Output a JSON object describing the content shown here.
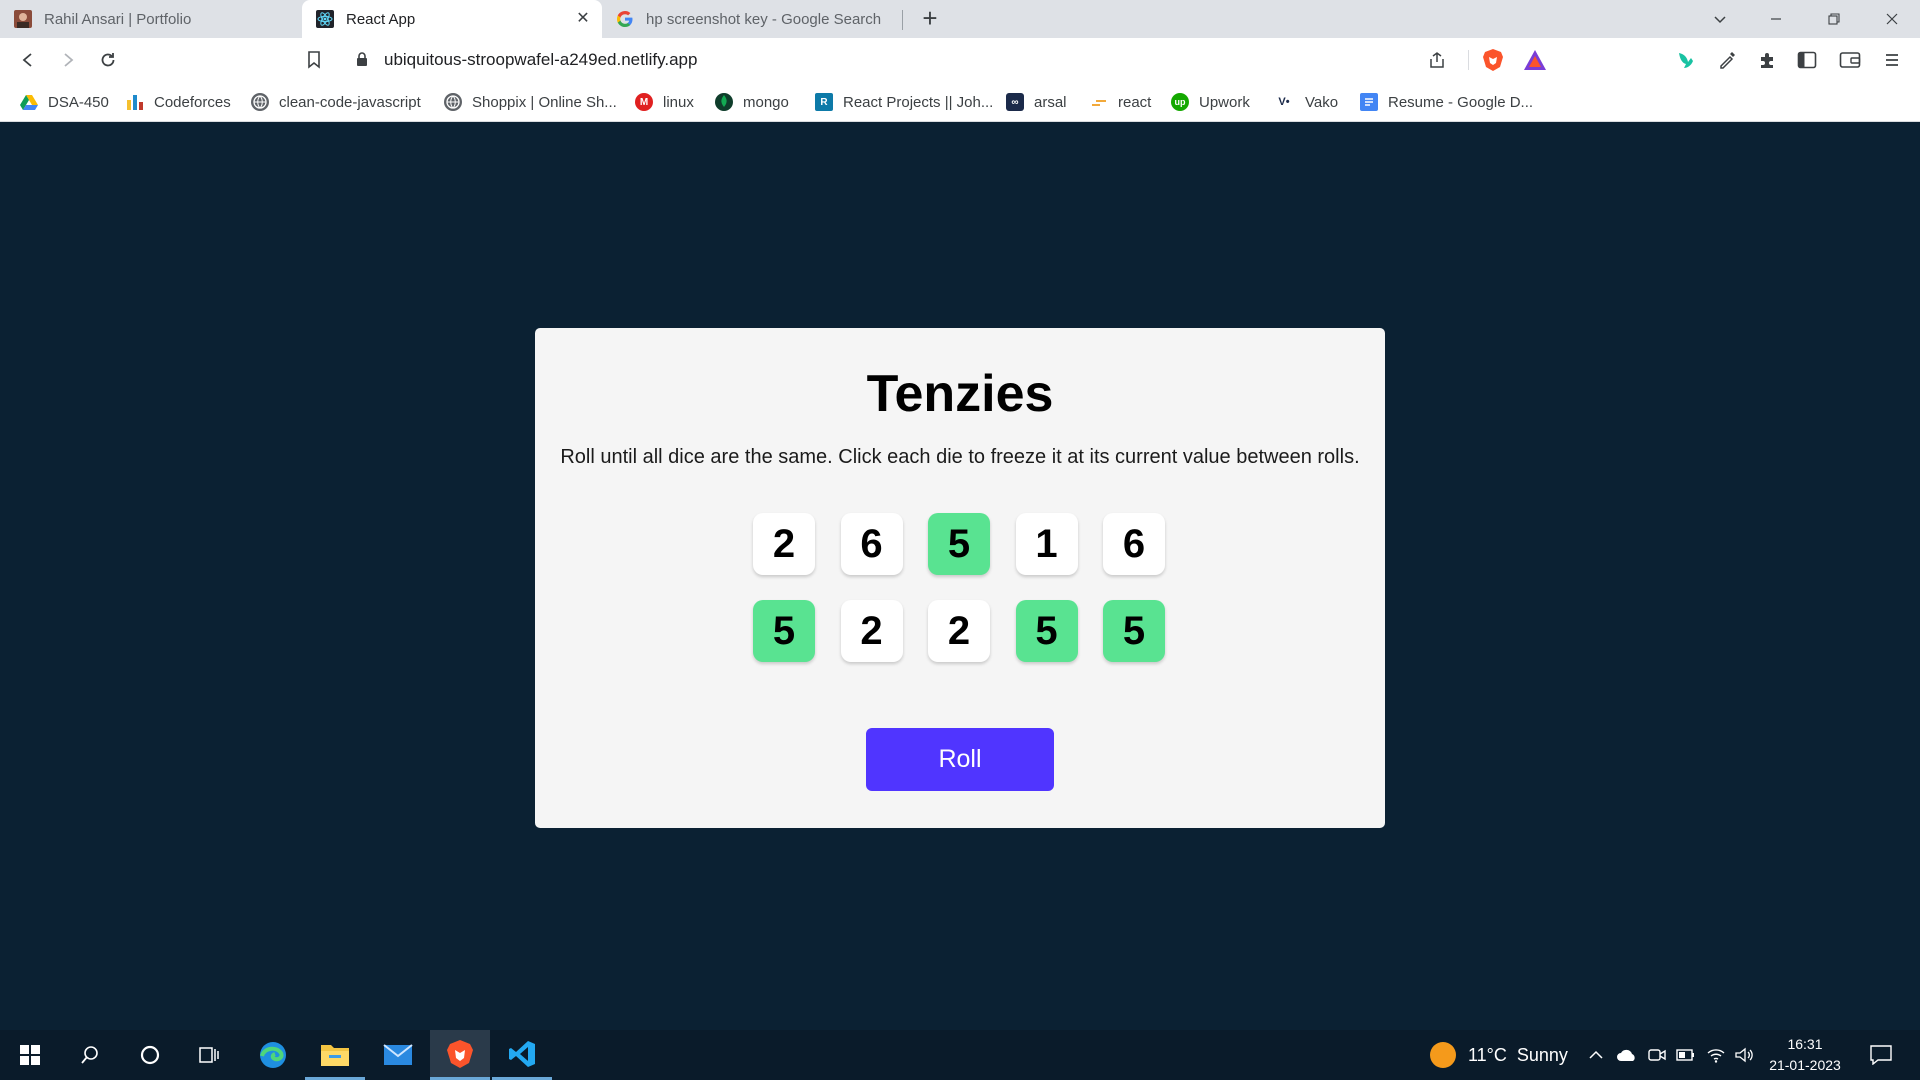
{
  "browser": {
    "tabs": [
      {
        "title": "Rahil Ansari | Portfolio",
        "active": false
      },
      {
        "title": "React App",
        "active": true
      },
      {
        "title": "hp screenshot key - Google Search",
        "active": false
      }
    ],
    "url": "ubiquitous-stroopwafel-a249ed.netlify.app",
    "bookmarks": [
      {
        "label": "DSA-450",
        "icon": "google-drive-icon"
      },
      {
        "label": "Codeforces",
        "icon": "codeforces-icon"
      },
      {
        "label": "clean-code-javascript",
        "icon": "globe-icon"
      },
      {
        "label": "Shoppix | Online Sh...",
        "icon": "globe-icon"
      },
      {
        "label": "linux",
        "icon": "gmail-icon"
      },
      {
        "label": "mongo",
        "icon": "mongo-leaf-icon"
      },
      {
        "label": "React Projects || Joh...",
        "icon": "replit-icon"
      },
      {
        "label": "arsal",
        "icon": "infinity-icon"
      },
      {
        "label": "react",
        "icon": "bookmark-icon"
      },
      {
        "label": "Upwork",
        "icon": "upwork-icon"
      },
      {
        "label": "Vako",
        "icon": "vako-icon"
      },
      {
        "label": "Resume - Google D...",
        "icon": "google-docs-icon"
      }
    ]
  },
  "app": {
    "title": "Tenzies",
    "instructions": "Roll until all dice are the same. Click each die to freeze it at its current value between rolls.",
    "dice": [
      {
        "value": "2",
        "held": false
      },
      {
        "value": "6",
        "held": false
      },
      {
        "value": "5",
        "held": true
      },
      {
        "value": "1",
        "held": false
      },
      {
        "value": "6",
        "held": false
      },
      {
        "value": "5",
        "held": true
      },
      {
        "value": "2",
        "held": false
      },
      {
        "value": "2",
        "held": false
      },
      {
        "value": "5",
        "held": true
      },
      {
        "value": "5",
        "held": true
      }
    ],
    "roll_label": "Roll",
    "colors": {
      "background": "#0b2133",
      "card": "#f5f5f5",
      "held": "#59e391",
      "button": "#5035ff"
    }
  },
  "taskbar": {
    "weather": "11°C  Sunny",
    "time": "16:31",
    "date": "21-01-2023"
  }
}
